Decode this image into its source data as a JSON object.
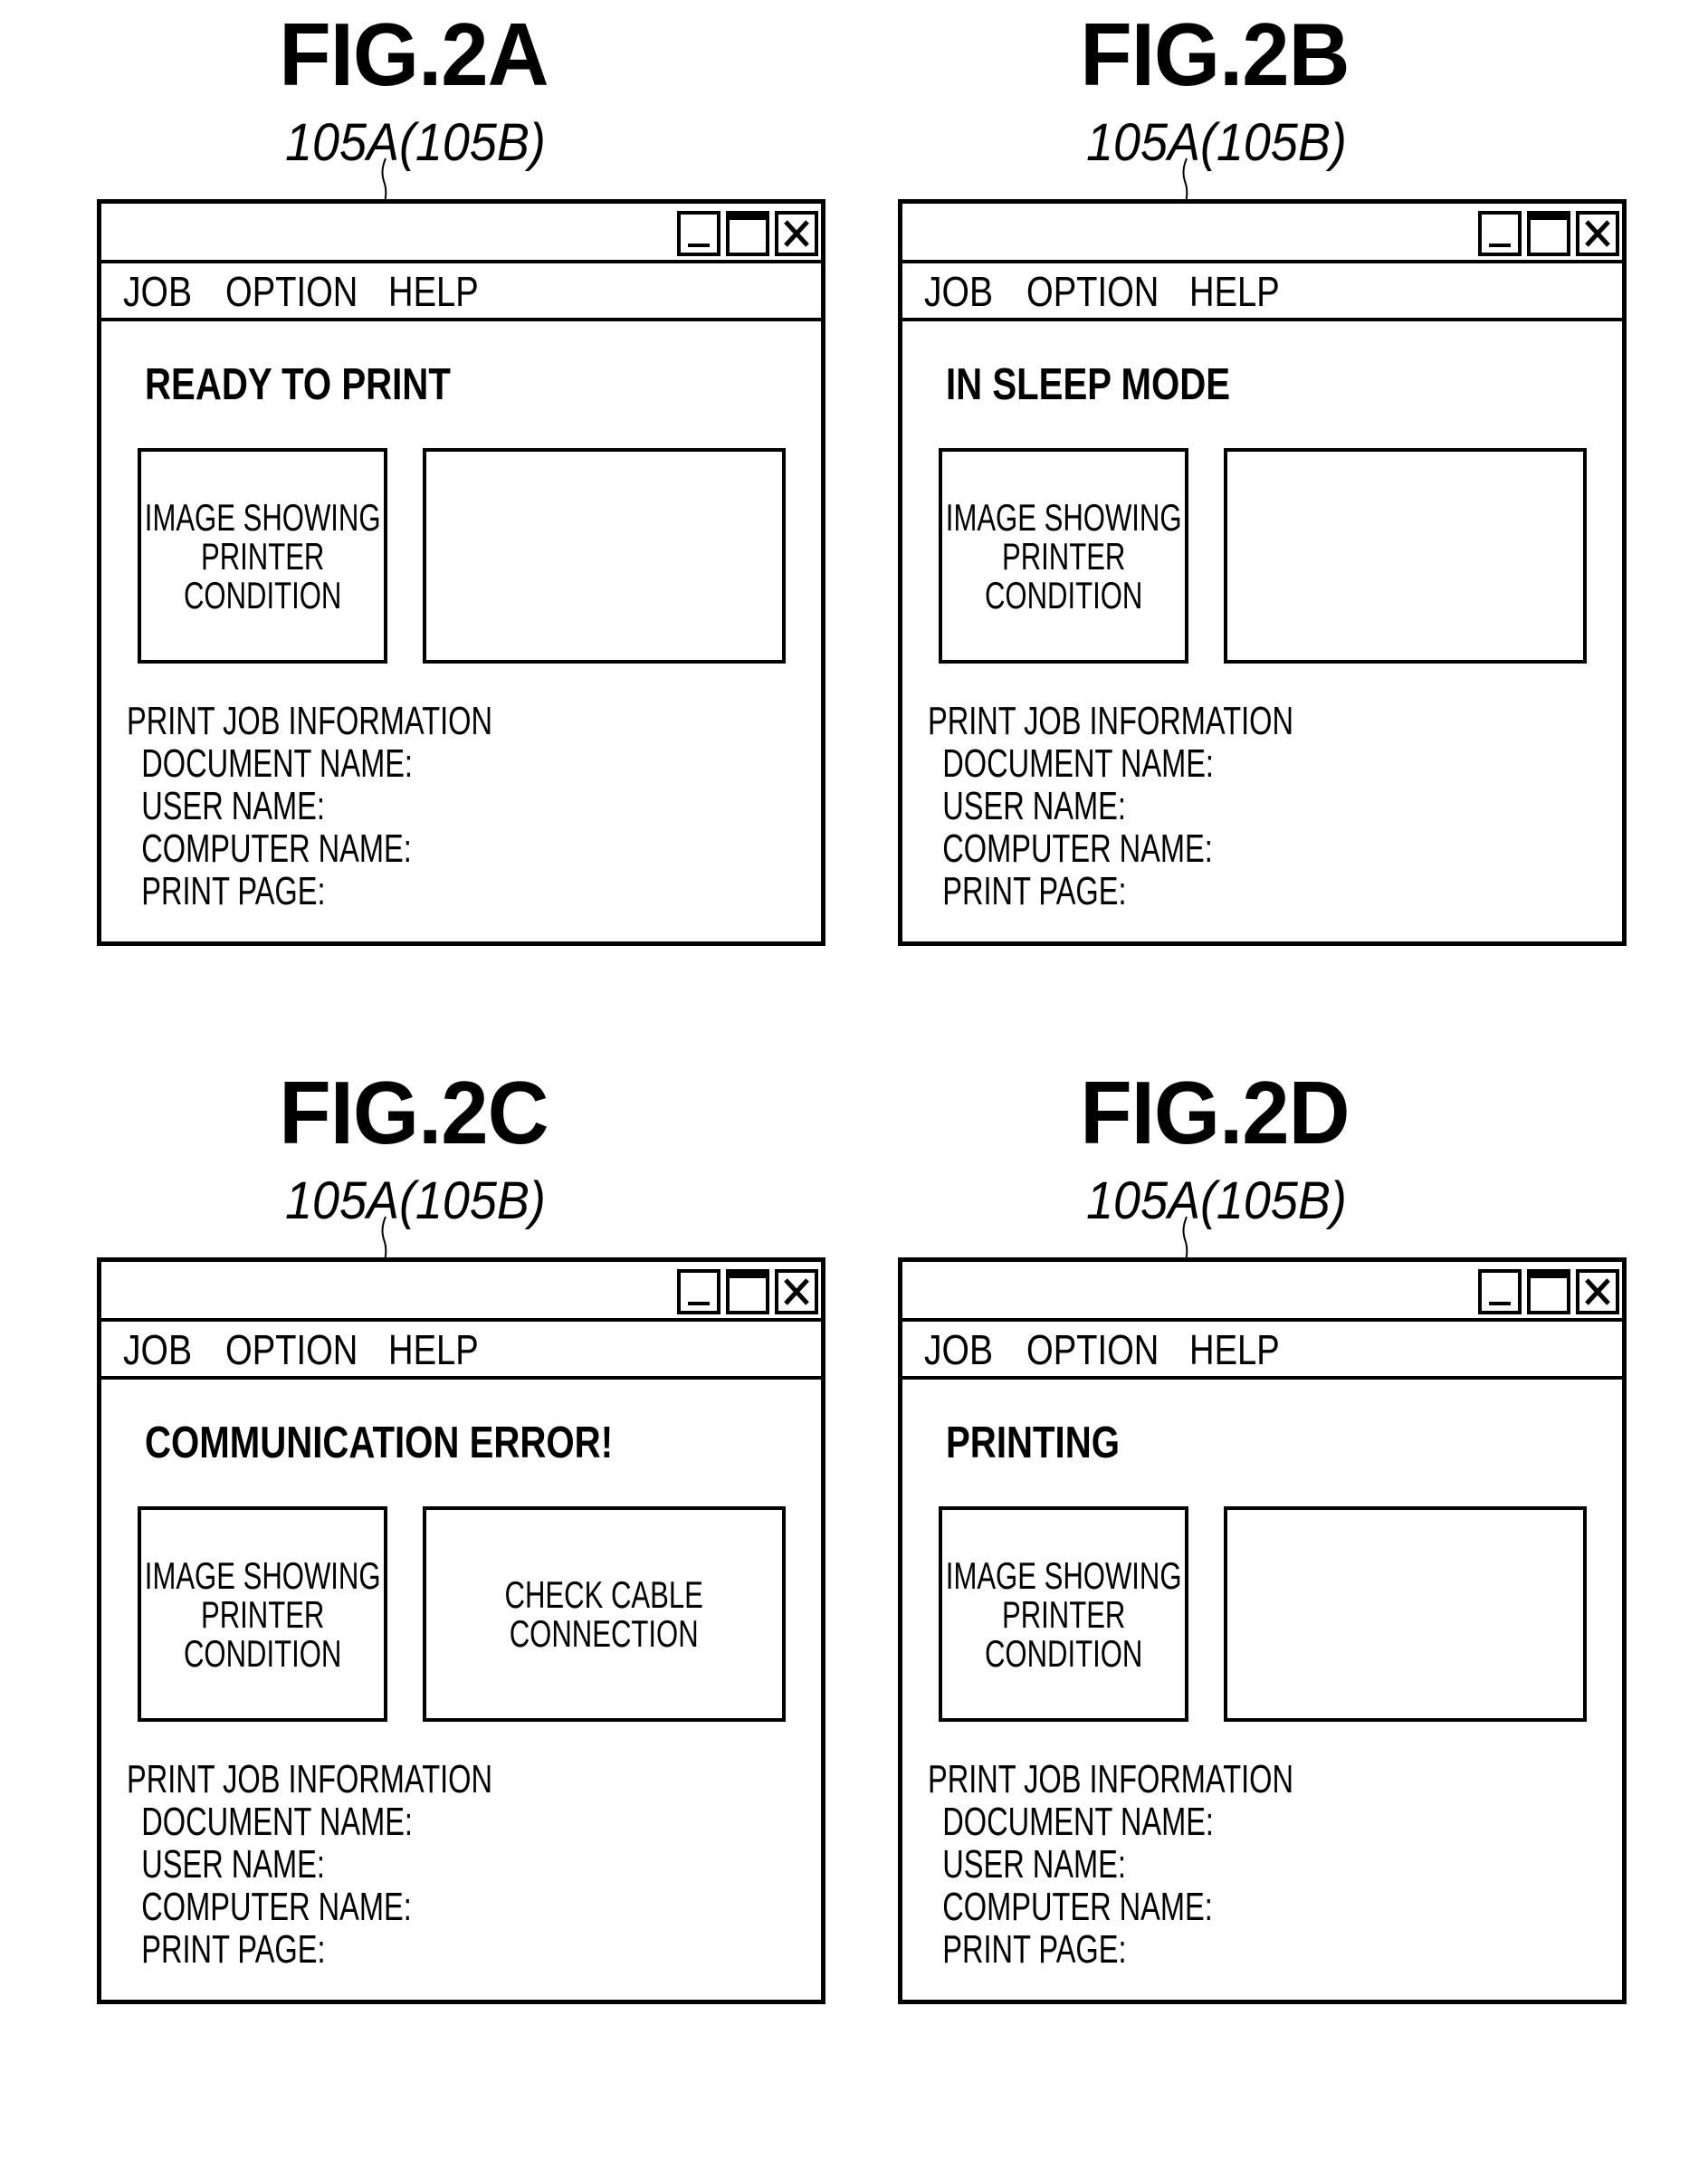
{
  "window_common": {
    "menu": [
      "JOB",
      "OPTION",
      "HELP"
    ],
    "window_buttons": [
      {
        "name": "minimize",
        "icon": "minimize-icon"
      },
      {
        "name": "maximize",
        "icon": "maximize-icon"
      },
      {
        "name": "close",
        "icon": "close-icon"
      }
    ],
    "image_box_text": [
      "IMAGE SHOWING",
      "PRINTER",
      "CONDITION"
    ],
    "info": {
      "title": "PRINT JOB INFORMATION",
      "rows": [
        {
          "label": "DOCUMENT NAME:",
          "value": ""
        },
        {
          "label": "USER NAME:",
          "value": ""
        },
        {
          "label": "COMPUTER NAME:",
          "value": ""
        },
        {
          "label": "PRINT PAGE:",
          "value": ""
        }
      ]
    }
  },
  "panels": [
    {
      "figure": "FIG.2A",
      "reference": "105A(105B)",
      "status": "READY TO PRINT",
      "message": []
    },
    {
      "figure": "FIG.2B",
      "reference": "105A(105B)",
      "status": "IN SLEEP MODE",
      "message": []
    },
    {
      "figure": "FIG.2C",
      "reference": "105A(105B)",
      "status": "COMMUNICATION ERROR!",
      "message": [
        "CHECK CABLE",
        "CONNECTION"
      ]
    },
    {
      "figure": "FIG.2D",
      "reference": "105A(105B)",
      "status": "PRINTING",
      "message": []
    }
  ]
}
